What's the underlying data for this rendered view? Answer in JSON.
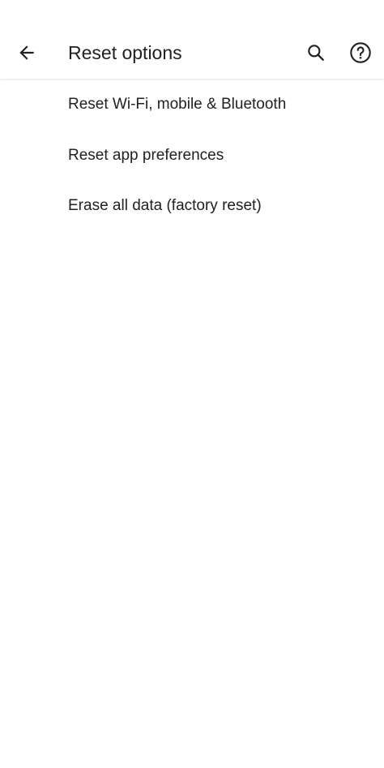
{
  "app_bar": {
    "title": "Reset options",
    "back_icon": "arrow-back-icon",
    "search_icon": "search-icon",
    "help_icon": "help-circle-icon"
  },
  "options": [
    {
      "label": "Reset Wi-Fi, mobile & Bluetooth"
    },
    {
      "label": "Reset app preferences"
    },
    {
      "label": "Erase all data (factory reset)"
    }
  ],
  "colors": {
    "background": "#ffffff",
    "text_primary": "#202124",
    "icon": "#202124"
  }
}
